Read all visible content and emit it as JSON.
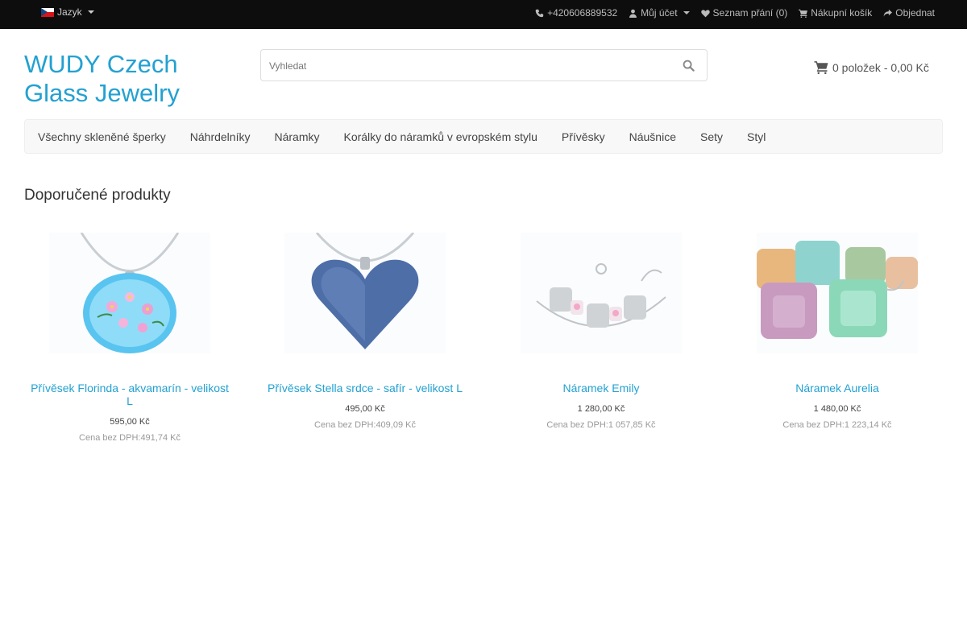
{
  "topbar": {
    "language_label": "Jazyk",
    "phone": "+420606889532",
    "account": "Můj účet",
    "wishlist": "Seznam přání (0)",
    "cart_link": "Nákupní košík",
    "checkout": "Objednat"
  },
  "header": {
    "logo": "WUDY Czech Glass Jewelry",
    "search_placeholder": "Vyhledat",
    "cart_summary": "0 položek - 0,00 Kč"
  },
  "nav": {
    "items": [
      "Všechny skleněné šperky",
      "Náhrdelníky",
      "Náramky",
      "Korálky do náramků v evropském stylu",
      "Přívěsky",
      "Náušnice",
      "Sety",
      "Styl"
    ]
  },
  "section": {
    "title": "Doporučené produkty"
  },
  "products": [
    {
      "name": "Přívěsek Florinda - akvamarín - velikost L",
      "price": "595,00 Kč",
      "tax": "Cena bez DPH:491,74 Kč"
    },
    {
      "name": "Přívěsek Stella srdce - safír - velikost L",
      "price": "495,00 Kč",
      "tax": "Cena bez DPH:409,09 Kč"
    },
    {
      "name": "Náramek Emily",
      "price": "1 280,00 Kč",
      "tax": "Cena bez DPH:1 057,85 Kč"
    },
    {
      "name": "Náramek Aurelia",
      "price": "1 480,00 Kč",
      "tax": "Cena bez DPH:1 223,14 Kč"
    }
  ],
  "colors": {
    "link": "#23a1d1",
    "topbar": "#0d0d0d",
    "nav_bg": "#f8f8f8"
  }
}
